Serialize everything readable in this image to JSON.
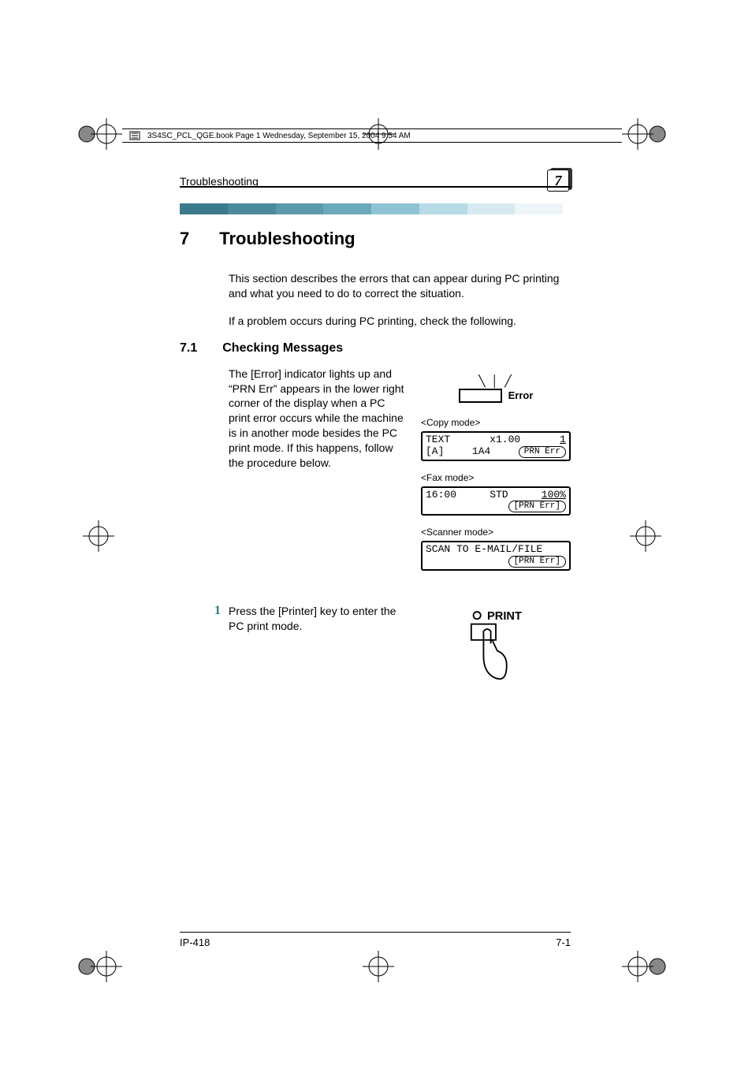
{
  "header": {
    "file_info": "3S4SC_PCL_QGE.book  Page 1  Wednesday, September 15, 2004  9:54 AM"
  },
  "running_header": {
    "title": "Troubleshooting",
    "chapter_number": "7"
  },
  "h1": {
    "number": "7",
    "title": "Troubleshooting"
  },
  "intro": {
    "p1": "This section describes the errors that can appear during PC printing and what you need to do to correct the situation.",
    "p2": "If a problem occurs during PC printing, check the following."
  },
  "h2": {
    "number": "7.1",
    "title": "Checking Messages"
  },
  "section": {
    "p1": "The [Error] indicator lights up and “PRN Err” appears in the lower right corner of the display when a PC print error occurs while the machine is in another mode besides the PC print mode. If this happens, follow the procedure below."
  },
  "error_indicator": {
    "label": "Error"
  },
  "modes": {
    "copy": {
      "label": "<Copy mode>",
      "line1_left": "TEXT",
      "line1_mid": "x1.00",
      "line1_right": "1",
      "line2_left": "[A]",
      "line2_mid": "1A4",
      "line2_right": "PRN Err"
    },
    "fax": {
      "label": "<Fax mode>",
      "line1_left": "16:00",
      "line1_mid": "STD",
      "line1_right": "100%",
      "line2_right": "[PRN Err]"
    },
    "scanner": {
      "label": "<Scanner mode>",
      "line1": "SCAN TO E-MAIL/FILE",
      "line2_right": "[PRN Err]"
    }
  },
  "steps": {
    "s1": {
      "num": "1",
      "text": "Press the [Printer] key to enter the PC print mode.",
      "fig_label": "PRINT"
    }
  },
  "footer": {
    "left": "IP-418",
    "right": "7-1"
  }
}
